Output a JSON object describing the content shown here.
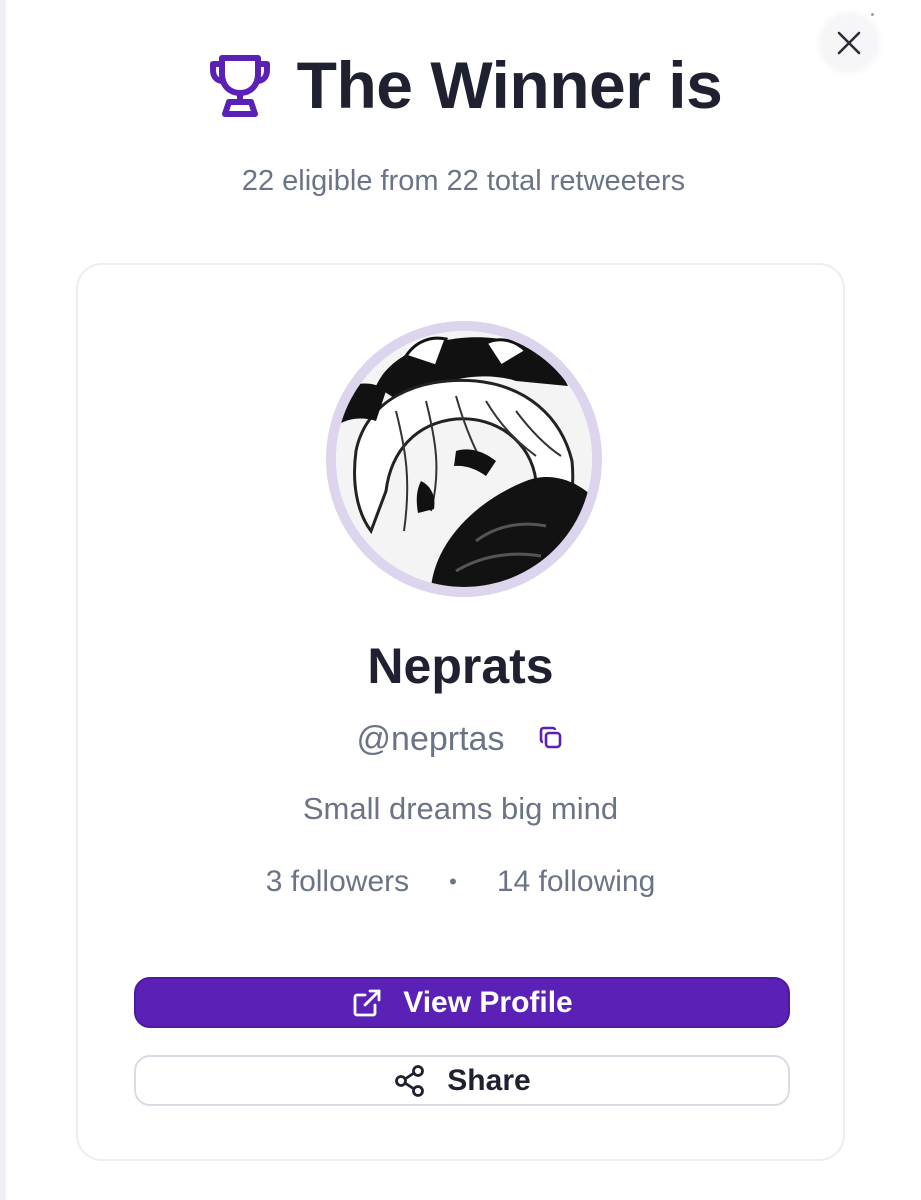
{
  "header": {
    "title": "The Winner is",
    "trophy_icon": "trophy-icon",
    "accent_color": "#5b21b6"
  },
  "subtitle": "22 eligible from 22 total retweeters",
  "close_icon": "close-icon",
  "winner": {
    "name": "Neprats",
    "handle": "@neprtas",
    "bio": "Small dreams big mind",
    "followers_label": "3 followers",
    "following_label": "14 following",
    "separator": "•"
  },
  "actions": {
    "view_profile_label": "View Profile",
    "view_profile_icon": "external-link-icon",
    "share_label": "Share",
    "share_icon": "share-icon"
  }
}
